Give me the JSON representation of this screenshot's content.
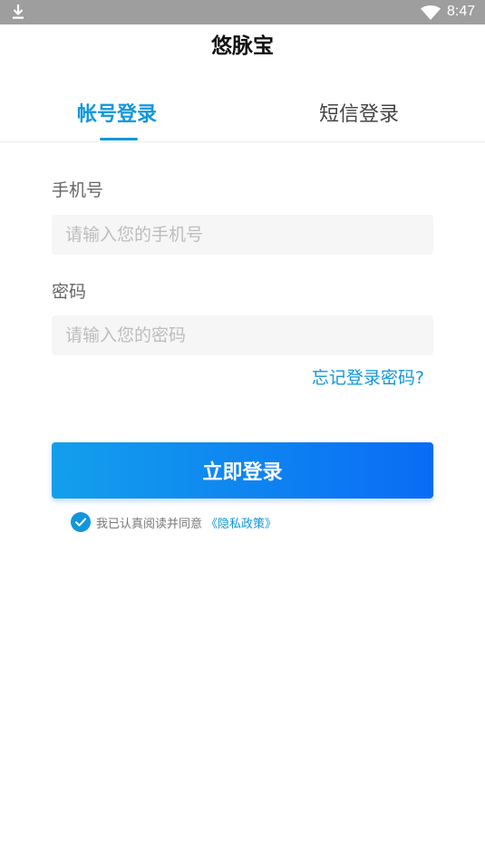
{
  "status_bar": {
    "time": "8:47",
    "icons": [
      "download-icon",
      "wifi-icon"
    ]
  },
  "app": {
    "title": "悠脉宝"
  },
  "tabs": {
    "account_login": "帐号登录",
    "sms_login": "短信登录",
    "active": "account_login"
  },
  "form": {
    "phone_label": "手机号",
    "phone_placeholder": "请输入您的手机号",
    "password_label": "密码",
    "password_placeholder": "请输入您的密码",
    "forgot_password": "忘记登录密码?"
  },
  "login_button": {
    "label": "立即登录"
  },
  "agreement": {
    "checked": true,
    "text": "我已认真阅读并同意",
    "privacy_link": "《隐私政策》"
  },
  "colors": {
    "accent": "#1296db",
    "status_bar": "#9e9e9e",
    "button_gradient_start": "#139fec",
    "button_gradient_end": "#0a6cf5"
  }
}
